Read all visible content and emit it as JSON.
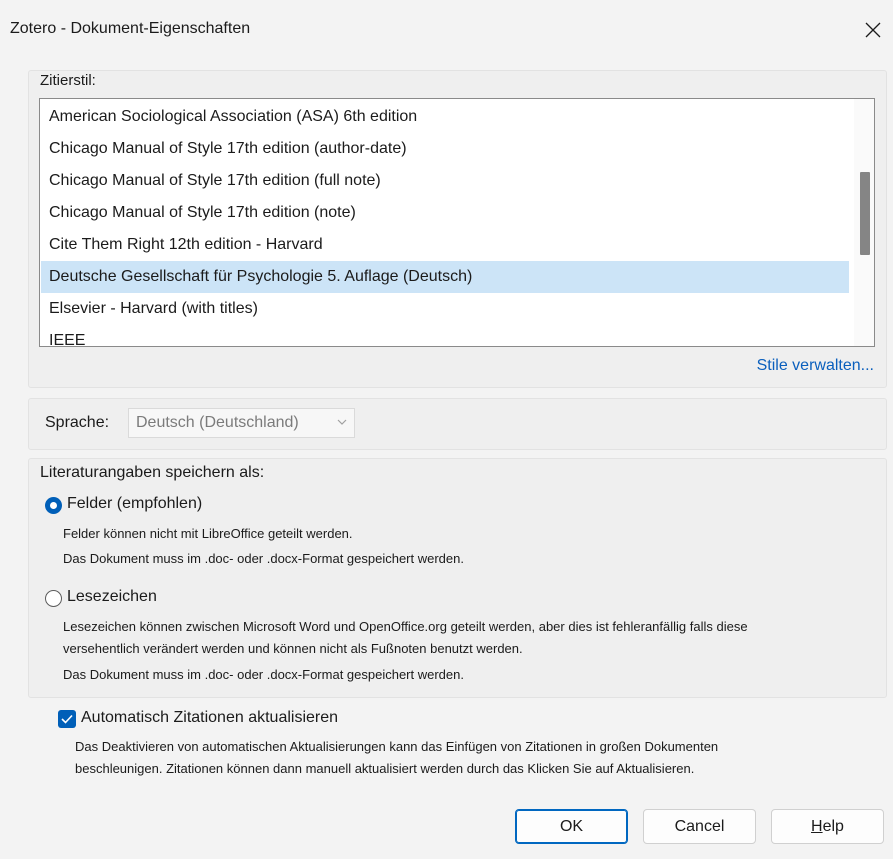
{
  "window": {
    "title": "Zotero - Dokument-Eigenschaften"
  },
  "citation_style": {
    "label": "Zitierstil:",
    "items": [
      "American Sociological Association (ASA) 6th edition",
      "Chicago Manual of Style 17th edition (author-date)",
      "Chicago Manual of Style 17th edition (full note)",
      "Chicago Manual of Style 17th edition (note)",
      "Cite Them Right 12th edition - Harvard",
      "Deutsche Gesellschaft für Psychologie 5. Auflage (Deutsch)",
      "Elsevier - Harvard (with titles)",
      "IEEE"
    ],
    "selected": "Deutsche Gesellschaft für Psychologie 5. Auflage (Deutsch)",
    "manage_link": "Stile verwalten..."
  },
  "language": {
    "label": "Sprache:",
    "value": "Deutsch (Deutschland)"
  },
  "storage": {
    "label": "Literaturangaben speichern als:",
    "fields": {
      "label": "Felder (empfohlen)",
      "selected": true,
      "notes": [
        "Felder können nicht mit LibreOffice geteilt werden.",
        "Das Dokument muss im .doc- oder .docx-Format gespeichert werden."
      ]
    },
    "bookmarks": {
      "label": "Lesezeichen",
      "selected": false,
      "notes": [
        "Lesezeichen können zwischen Microsoft Word und OpenOffice.org geteilt werden, aber dies ist fehleranfällig falls diese",
        "versehentlich verändert werden und können nicht als Fußnoten benutzt werden.",
        "Das Dokument muss im .doc- oder .docx-Format gespeichert werden."
      ]
    }
  },
  "auto_update": {
    "label": "Automatisch Zitationen aktualisieren",
    "checked": true,
    "notes": [
      "Das Deaktivieren von automatischen Aktualisierungen kann das Einfügen von Zitationen in großen Dokumenten",
      "beschleunigen. Zitationen können dann manuell aktualisiert werden durch das Klicken Sie auf Aktualisieren."
    ]
  },
  "buttons": {
    "ok": "OK",
    "cancel": "Cancel",
    "help_prefix": "H",
    "help_rest": "elp"
  },
  "colors": {
    "accent": "#005fb8",
    "selection": "#cce4f7",
    "link": "#0a5fbd"
  }
}
